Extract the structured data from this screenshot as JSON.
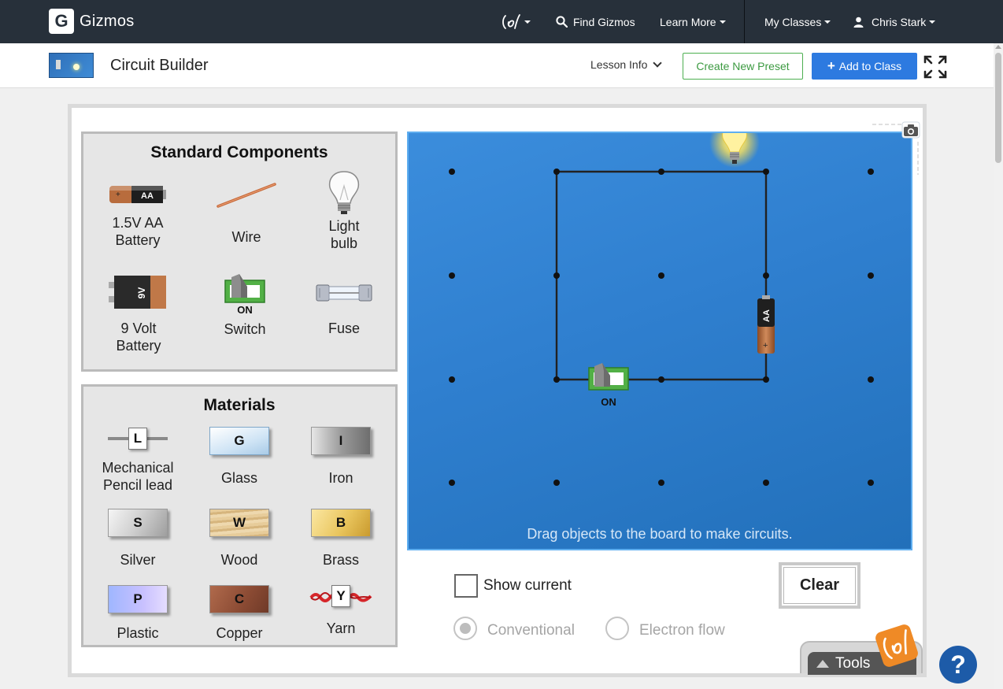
{
  "nav": {
    "brand_letter": "G",
    "brand": "Gizmos",
    "find": "Find Gizmos",
    "learn": "Learn More",
    "classes": "My Classes",
    "user": "Chris Stark"
  },
  "header": {
    "title": "Circuit Builder",
    "lesson_info": "Lesson Info",
    "create_preset": "Create New Preset",
    "add_class": "Add to Class",
    "add_icon": "+"
  },
  "standard": {
    "title": "Standard Components",
    "battery_aa_line1": "1.5V AA",
    "battery_aa_line2": "Battery",
    "aa_icon_text": "AA",
    "wire": "Wire",
    "bulb_line1": "Light",
    "bulb_line2": "bulb",
    "battery9_line1": "9 Volt",
    "battery9_line2": "Battery",
    "nine_v_icon_text": "9V",
    "switch": "Switch",
    "switch_state": "ON",
    "fuse": "Fuse"
  },
  "materials": {
    "title": "Materials",
    "items": [
      {
        "letter": "L",
        "label1": "Mechanical",
        "label2": "Pencil lead"
      },
      {
        "letter": "G",
        "label1": "Glass"
      },
      {
        "letter": "I",
        "label1": "Iron"
      },
      {
        "letter": "S",
        "label1": "Silver"
      },
      {
        "letter": "W",
        "label1": "Wood"
      },
      {
        "letter": "B",
        "label1": "Brass"
      },
      {
        "letter": "P",
        "label1": "Plastic"
      },
      {
        "letter": "C",
        "label1": "Copper"
      },
      {
        "letter": "Y",
        "label1": "Yarn"
      }
    ]
  },
  "board": {
    "hint": "Drag objects to the board to make circuits.",
    "switch_state": "ON",
    "battery_text": "AA"
  },
  "controls": {
    "show_current": "Show current",
    "show_current_checked": false,
    "conventional": "Conventional",
    "electron_flow": "Electron flow",
    "selected_flow": "conventional",
    "clear": "Clear"
  },
  "tools": {
    "label": "Tools"
  },
  "help": {
    "label": "?"
  },
  "colors": {
    "nav_bg": "#27303a",
    "accent_blue": "#2d7ae0",
    "preset_green": "#3c9a41",
    "board_blue": "#2f7fcf",
    "tools_badge": "#ef8a26"
  }
}
